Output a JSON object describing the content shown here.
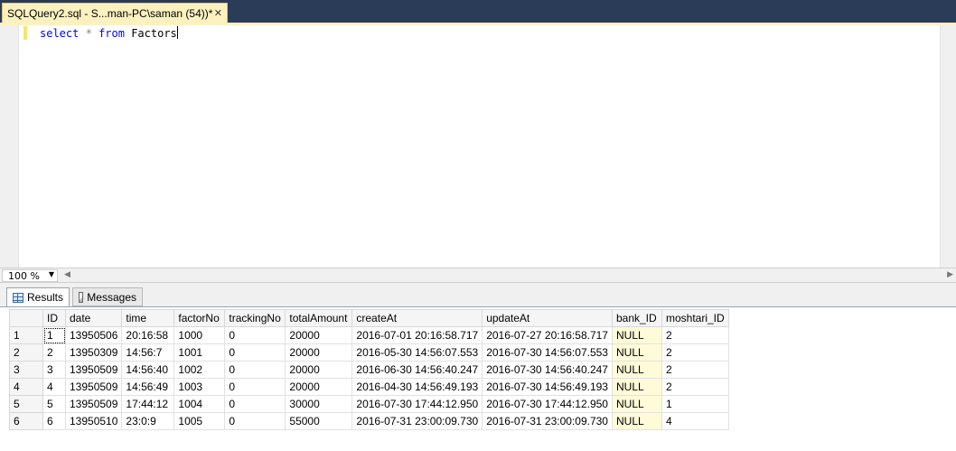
{
  "document_tab": {
    "title": "SQLQuery2.sql - S...man-PC\\saman (54))*",
    "close_glyph": "✕"
  },
  "editor": {
    "code": {
      "kw_select": "select",
      "star": "*",
      "kw_from": "from",
      "table": "Factors"
    }
  },
  "zoom": {
    "value": "100 %"
  },
  "result_tabs": {
    "results": "Results",
    "messages": "Messages"
  },
  "grid": {
    "columns": [
      "ID",
      "date",
      "time",
      "factorNo",
      "trackingNo",
      "totalAmount",
      "createAt",
      "updateAt",
      "bank_ID",
      "moshtari_ID"
    ],
    "rows": [
      {
        "n": "1",
        "cells": [
          "1",
          "13950506",
          "20:16:58",
          "1000",
          "0",
          "20000",
          "2016-07-01 20:16:58.717",
          "2016-07-27 20:16:58.717",
          "NULL",
          "2"
        ]
      },
      {
        "n": "2",
        "cells": [
          "2",
          "13950309",
          "14:56:7",
          "1001",
          "0",
          "20000",
          "2016-05-30 14:56:07.553",
          "2016-07-30 14:56:07.553",
          "NULL",
          "2"
        ]
      },
      {
        "n": "3",
        "cells": [
          "3",
          "13950509",
          "14:56:40",
          "1002",
          "0",
          "20000",
          "2016-06-30 14:56:40.247",
          "2016-07-30 14:56:40.247",
          "NULL",
          "2"
        ]
      },
      {
        "n": "4",
        "cells": [
          "4",
          "13950509",
          "14:56:49",
          "1003",
          "0",
          "20000",
          "2016-04-30 14:56:49.193",
          "2016-07-30 14:56:49.193",
          "NULL",
          "2"
        ]
      },
      {
        "n": "5",
        "cells": [
          "5",
          "13950509",
          "17:44:12",
          "1004",
          "0",
          "30000",
          "2016-07-30 17:44:12.950",
          "2016-07-30 17:44:12.950",
          "NULL",
          "1"
        ]
      },
      {
        "n": "6",
        "cells": [
          "6",
          "13950510",
          "23:0:9",
          "1005",
          "0",
          "55000",
          "2016-07-31 23:00:09.730",
          "2016-07-31 23:00:09.730",
          "NULL",
          "4"
        ]
      }
    ]
  },
  "colors": {
    "tabstrip_bg": "#2b3c59",
    "active_tab_bg": "#fdf1c0",
    "keyword": "#0000ff",
    "null_cell_bg": "#fffbd9"
  }
}
